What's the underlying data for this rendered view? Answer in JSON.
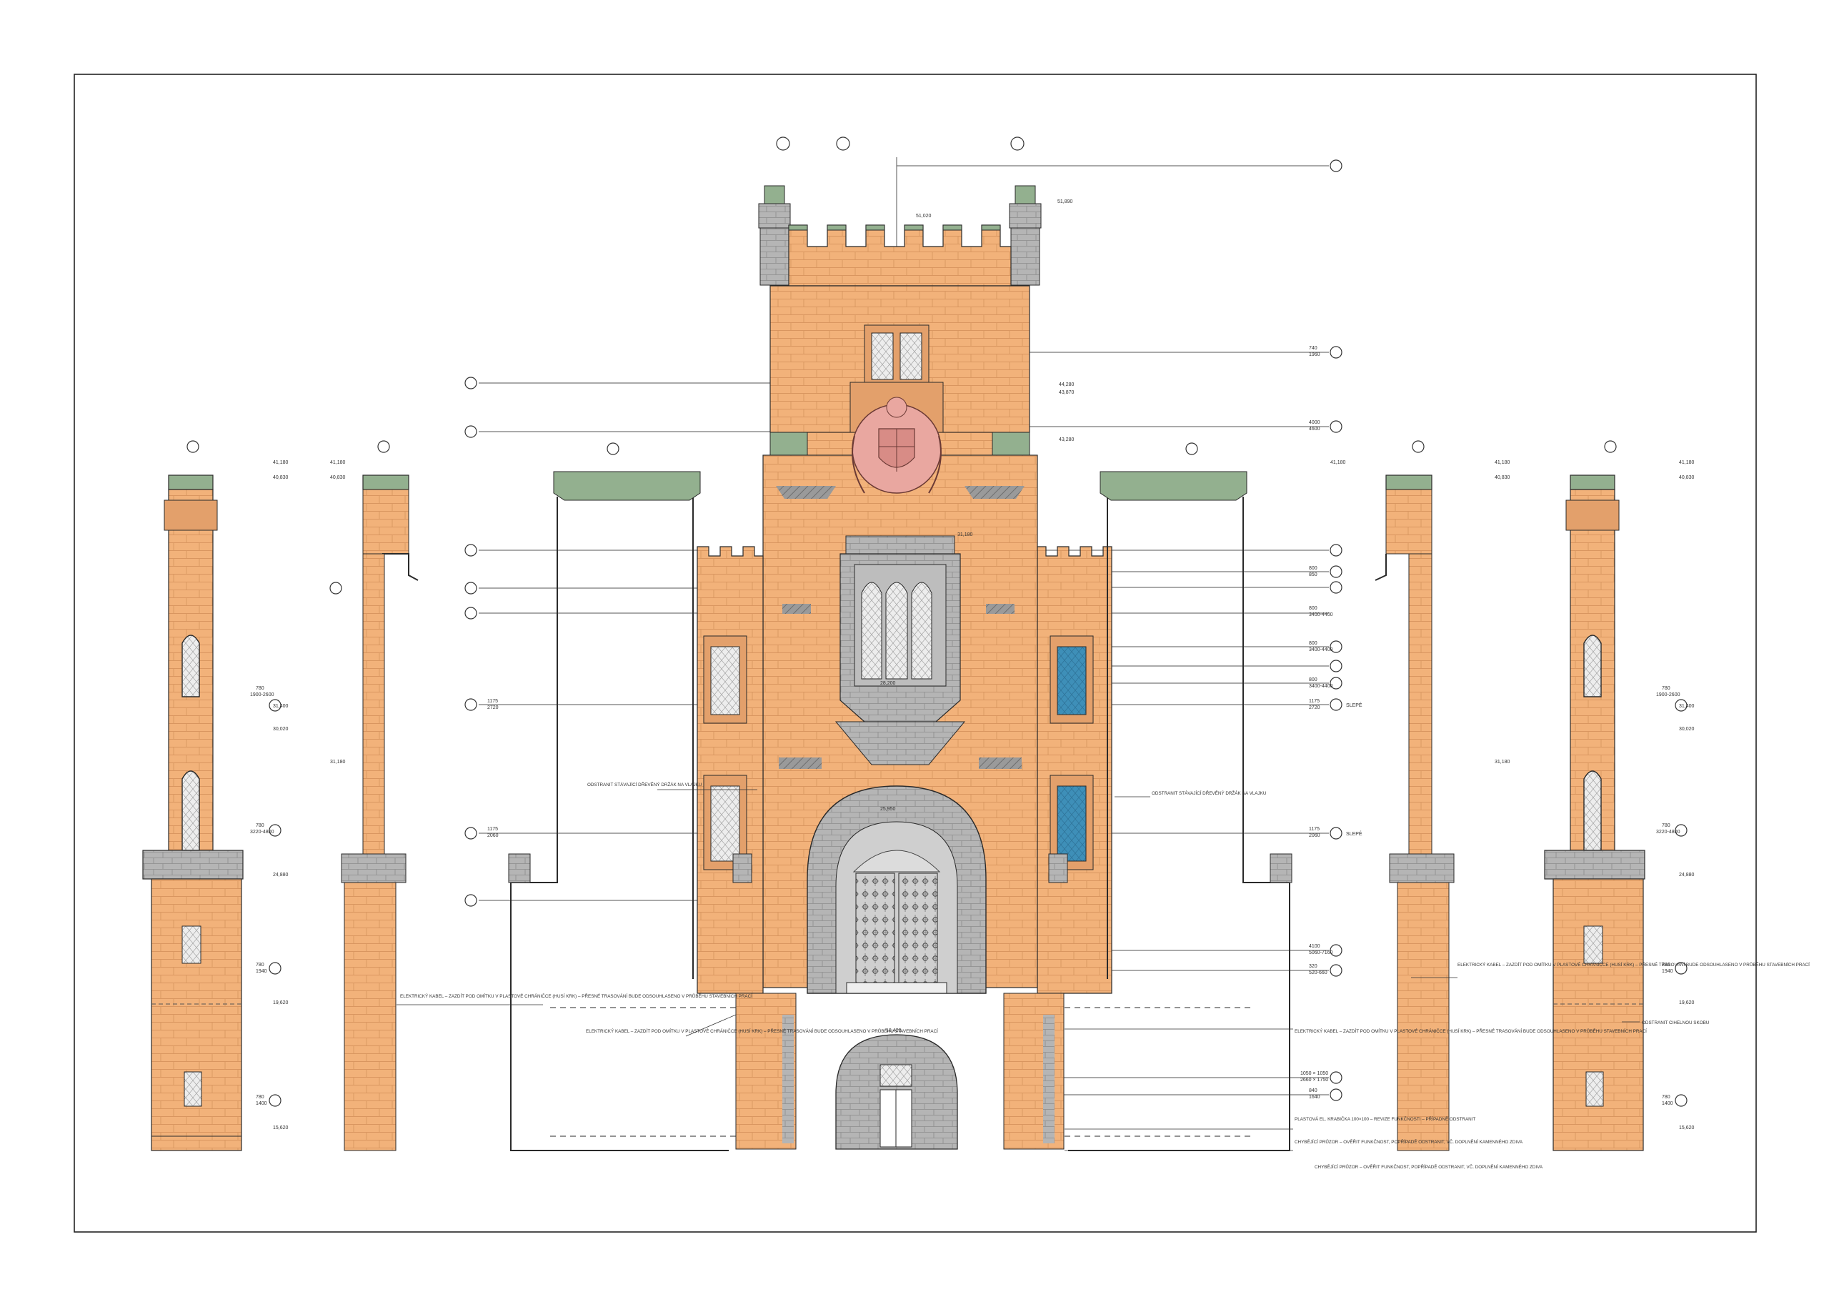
{
  "colors": {
    "sandstone": "#F2B27A",
    "sandstone_dark": "#D9955F",
    "copper_green": "#93B08F",
    "copper_dark": "#6E8F6B",
    "stone_grey": "#A8A8A8",
    "window_glass": "#E8E8E8",
    "window_blue": "#3E8FB8",
    "coat_of_arms": "#E9A7A0",
    "outline": "#2A2A2A",
    "leader": "#333333"
  },
  "icons": [
    "section-marker-icon",
    "level-marker-icon",
    "coat-of-arms-icon"
  ],
  "levels": {
    "tower_top": "51,890",
    "tower_roof": "51,020",
    "tower_band": "44,280",
    "tower_band2": "43,870",
    "tower_cornice": "43,280",
    "corner_top": "41,180",
    "corner_cornice": "40,830",
    "bay_top": "31,180",
    "bay_mid": "28,200",
    "bay_low": "23,520",
    "side_top": "29,880",
    "side_mid": "25,180",
    "gate": "25,950",
    "plinth": "19,620",
    "ground": "15,620",
    "low_door": "18,420",
    "slim_window": "31,400",
    "slim_a": "30,020",
    "slim_b": "24,880"
  },
  "window_labels": {
    "tower_window": [
      "740",
      "1960"
    ],
    "tower_band_a": [
      "4000",
      "4600"
    ],
    "bay_a": [
      "800",
      "850"
    ],
    "bay_b": [
      "800",
      "3400-4400"
    ],
    "bay_c": [
      "800",
      "3400-4400"
    ],
    "bay_d": [
      "800",
      "3400-4400"
    ],
    "side_upper": [
      "1175",
      "2720"
    ],
    "side_lower": [
      "1175",
      "2060"
    ],
    "gate_door": [
      "4100",
      "5060-7160"
    ],
    "gate_small": [
      "320",
      "520-660"
    ],
    "base_door": [
      "1050 × 1050",
      "2660 × 1750"
    ],
    "base_door2": [
      "840",
      "1640"
    ],
    "slim_upper": [
      "780",
      "1900-2600"
    ],
    "slim_lower": [
      "780",
      "3220-4800"
    ],
    "slim_door": [
      "780",
      "1940"
    ],
    "slim_base": [
      "780",
      "1400"
    ]
  },
  "slepe": "SLEPÉ",
  "notes": {
    "oak_left": "ODSTRANIT STÁVAJÍCÍ DŘEVĚNÝ DRŽÁK NA VLAJKU",
    "oak_right": "ODSTRANIT STÁVAJÍCÍ DŘEVĚNÝ DRŽÁK NA VLAJKU",
    "cable_left": "ELEKTRICKÝ KABEL – ZAZDÍT POD OMÍTKU V PLASTOVÉ CHRÁNIČCE (HUSÍ KRK) – PŘESNÉ TRASOVÁNÍ BUDE ODSOUHLASENO V PRŮBĚHU STAVEBNÍCH PRACÍ",
    "cable_center": "ELEKTRICKÝ KABEL – ZAZDÍT POD OMÍTKU V PLASTOVÉ CHRÁNIČCE (HUSÍ KRK) – PŘESNÉ TRASOVÁNÍ BUDE ODSOUHLASENO V PRŮBĚHU STAVEBNÍCH PRACÍ",
    "cable_right": "ELEKTRICKÝ KABEL – ZAZDÍT POD OMÍTKU V PLASTOVÉ CHRÁNIČCE (HUSÍ KRK) – PŘESNÉ TRASOVÁNÍ BUDE ODSOUHLASENO V PRŮBĚHU STAVEBNÍCH PRACÍ",
    "cable_far_right": "ELEKTRICKÝ KABEL – ZAZDÍT POD OMÍTKU V PLASTOVÉ CHRÁNIČCE (HUSÍ KRK) – PŘESNÉ TRASOVÁNÍ BUDE ODSOUHLASENO V PRŮBĚHU STAVEBNÍCH PRACÍ",
    "plastic": "PLASTOVÁ EL. KRABIČKA 100×100 – REVIZE FUNKČNOSTI – PŘÍPADNĚ ODSTRANIT",
    "window1": "CHYBĚJÍCÍ PRŮZOR – OVĚŘIT FUNKČNOST, POPŘÍPADĚ ODSTRANIT, VČ. DOPLNĚNÍ KAMENNÉHO ZDIVA",
    "window2": "CHYBĚJÍCÍ PRŮZOR – OVĚŘIT FUNKČNOST, POPŘÍPADĚ ODSTRANIT, VČ. DOPLNĚNÍ KAMENNÉHO ZDIVA",
    "brick": "ODSTRANIT CIHELNOU SKOBU"
  }
}
